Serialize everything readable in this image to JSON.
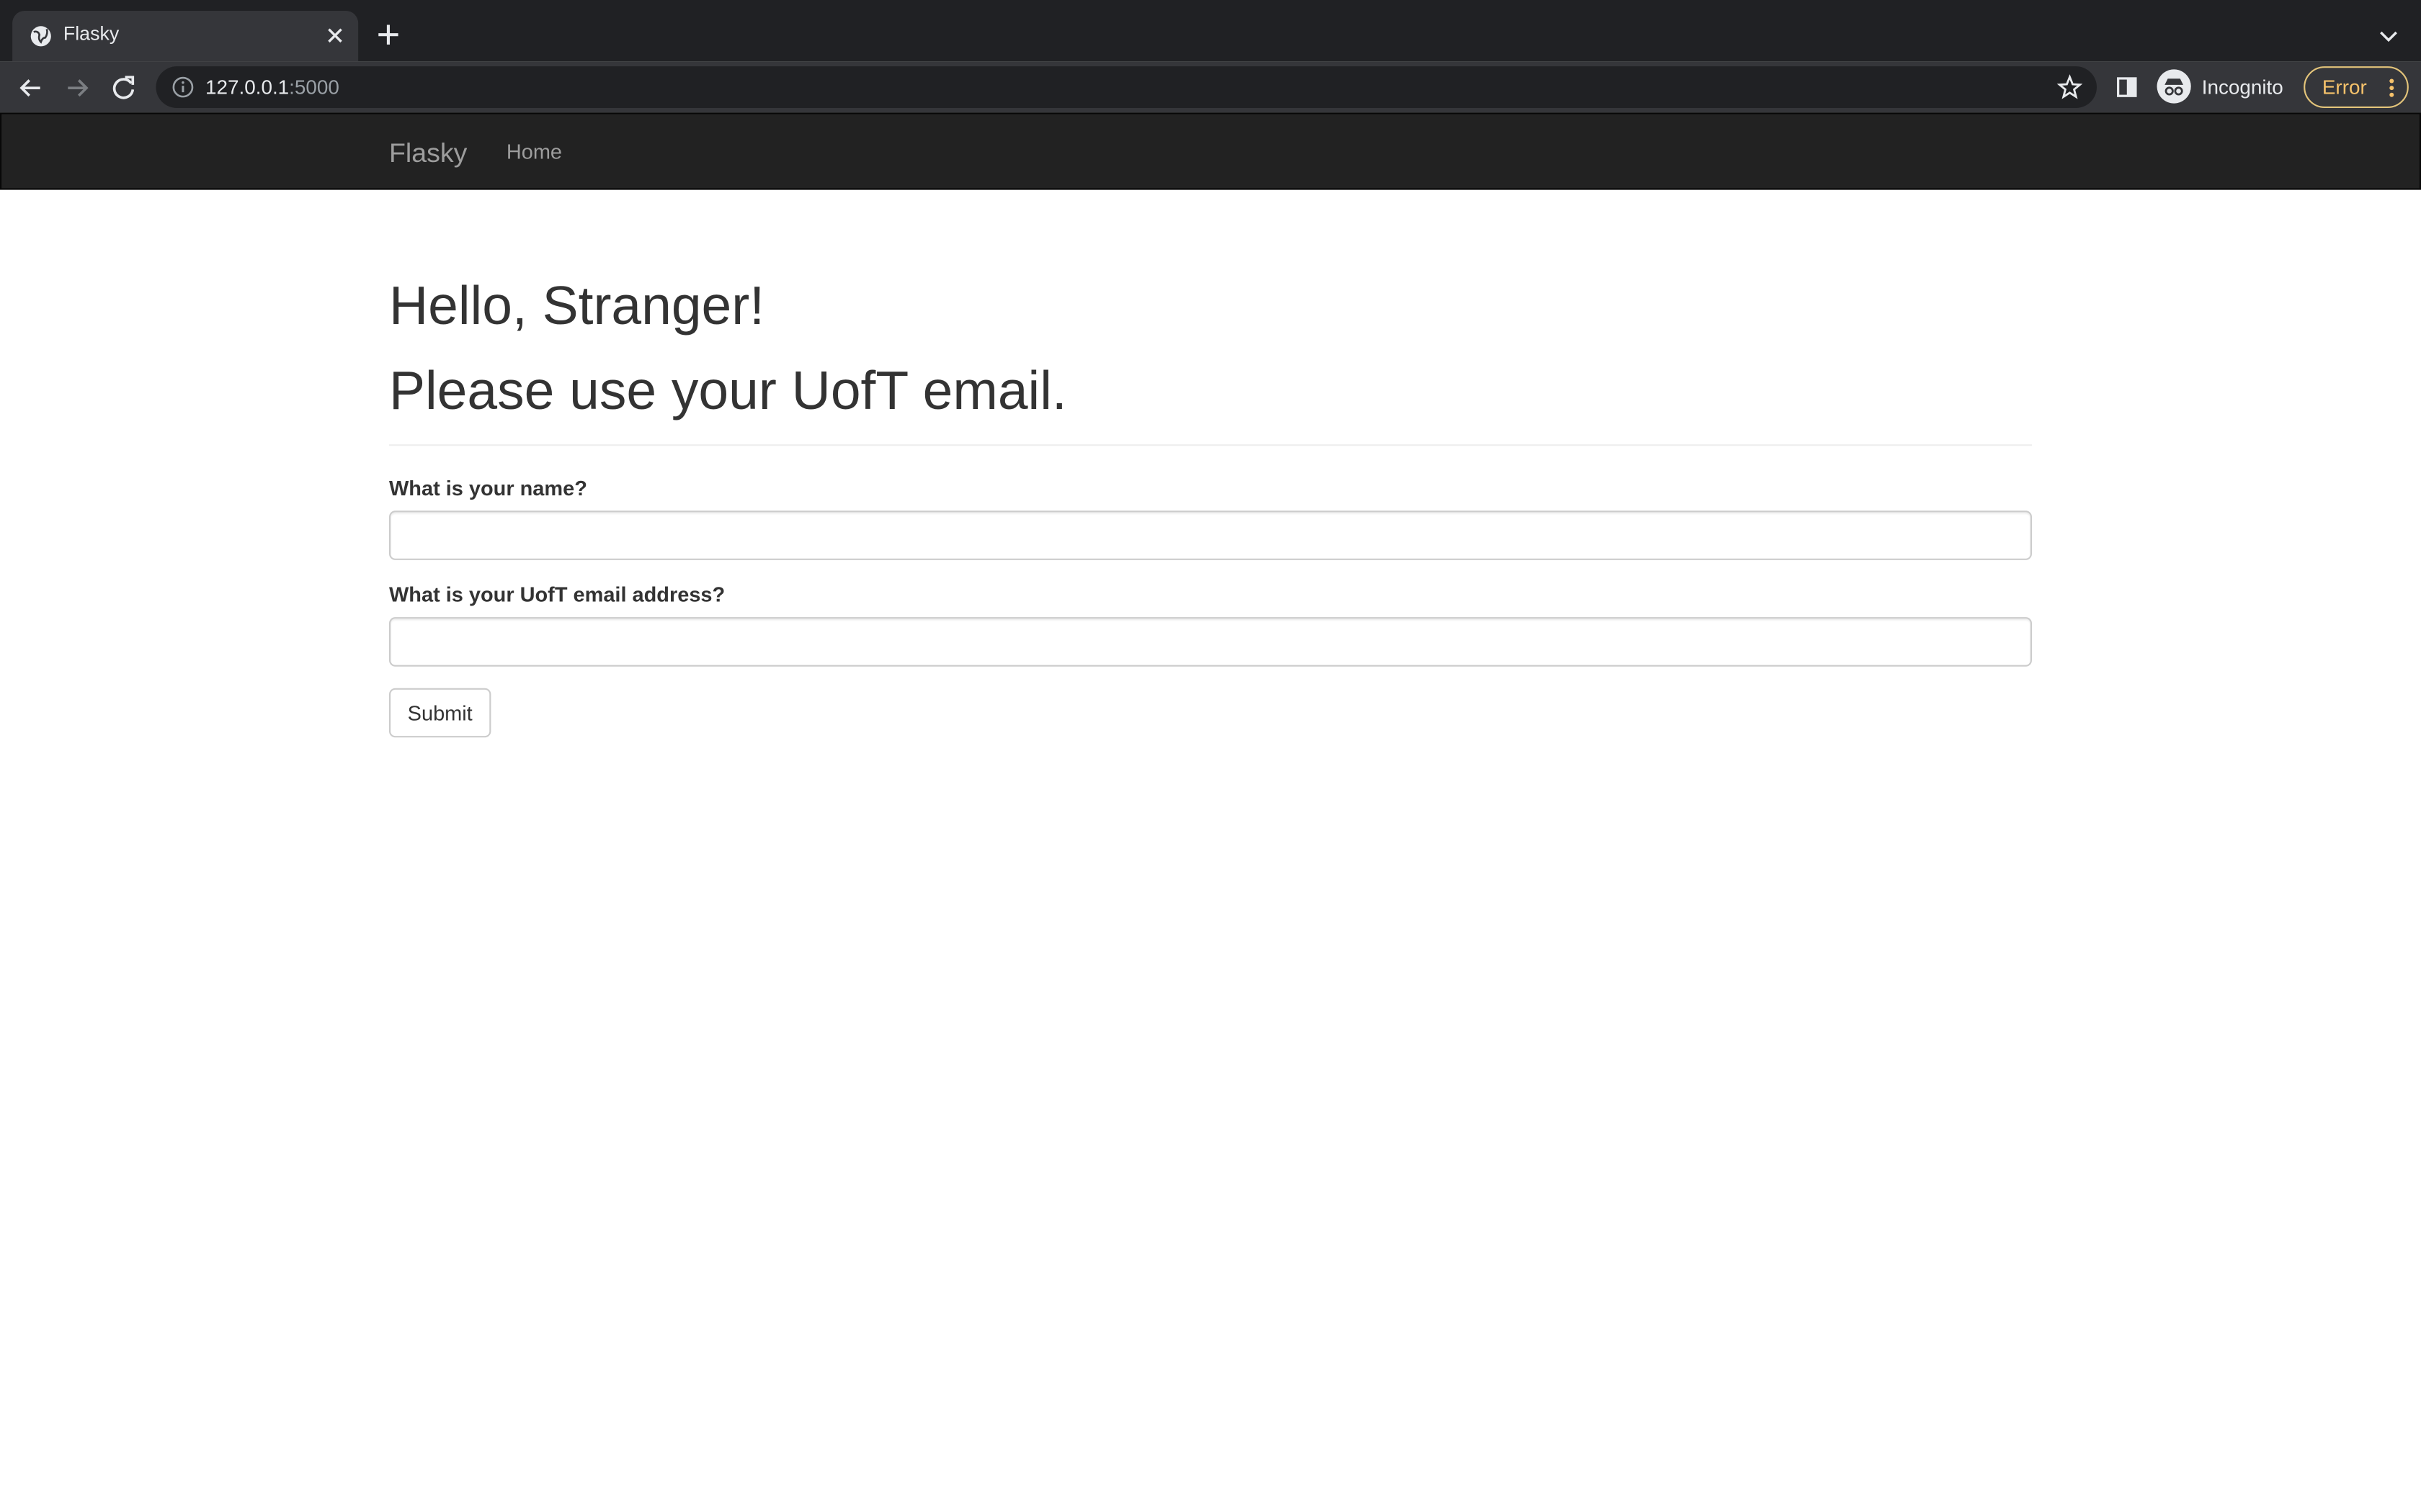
{
  "browser": {
    "tab_title": "Flasky",
    "url_host": "127.0.0.1",
    "url_port": ":5000",
    "profile_label": "Incognito",
    "error_label": "Error"
  },
  "navbar": {
    "brand": "Flasky",
    "home_link": "Home"
  },
  "main": {
    "greeting": "Hello, Stranger!",
    "instruction": "Please use your UofT email.",
    "form": {
      "name_label": "What is your name?",
      "name_value": "",
      "email_label": "What is your UofT email address?",
      "email_value": "",
      "submit_label": "Submit"
    }
  }
}
